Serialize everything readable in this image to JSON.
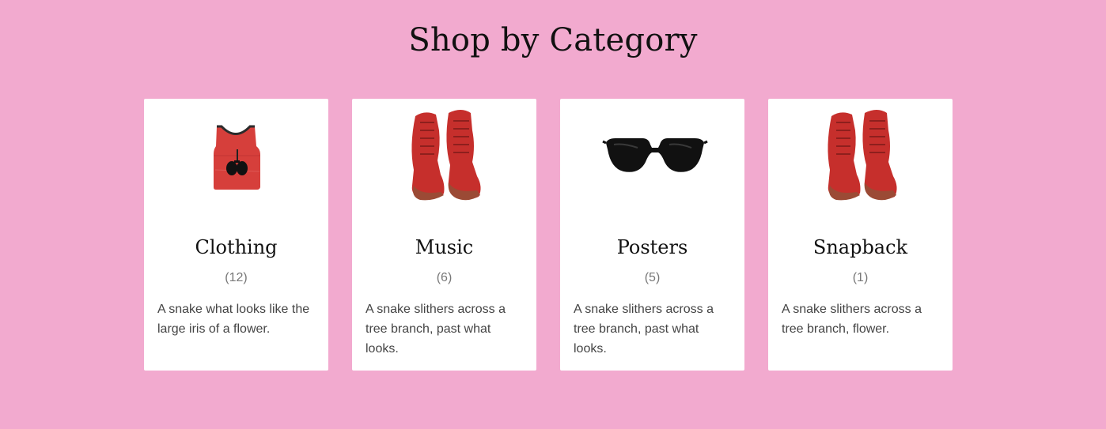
{
  "page": {
    "heading": "Shop by Category",
    "colors": {
      "background": "#f2aacf",
      "card": "#ffffff",
      "product_red": "#c8302e"
    }
  },
  "categories": [
    {
      "name": "Clothing",
      "count": "(12)",
      "description": "A snake what looks like the large iris of a flower.",
      "image": "tank-top-with-sunglasses"
    },
    {
      "name": "Music",
      "count": "(6)",
      "description": "A snake slithers across a tree branch, past what looks.",
      "image": "red-boots"
    },
    {
      "name": "Posters",
      "count": "(5)",
      "description": "A snake slithers across a tree branch, past what looks.",
      "image": "sunglasses"
    },
    {
      "name": "Snapback",
      "count": "(1)",
      "description": "A snake slithers across a tree branch, flower.",
      "image": "red-boots"
    }
  ]
}
